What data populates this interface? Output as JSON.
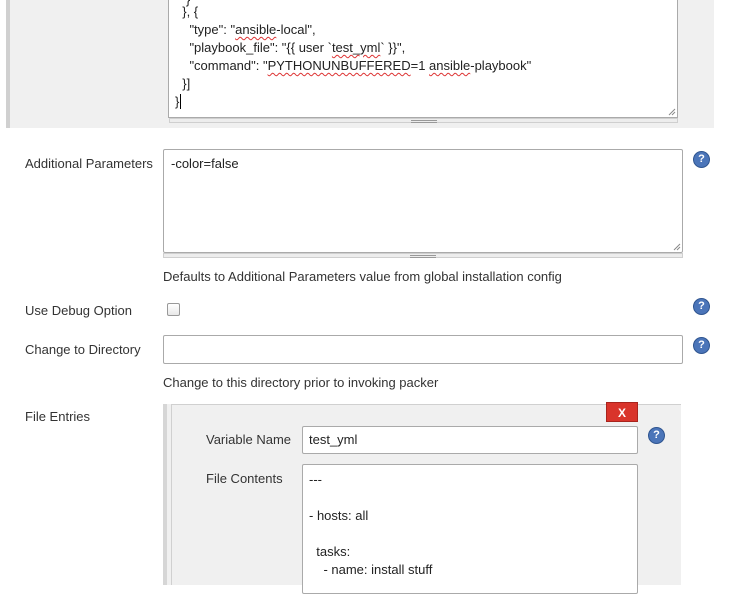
{
  "top_code": {
    "lines": [
      "  }, {",
      "    \"type\": \"",
      "ansible",
      "-local\",",
      "    \"playbook_file\": \"{{ user `",
      "test_yml",
      "` }}\",",
      "    \"command\": \"",
      "PYTHONUNBUFFERED",
      "=1 ",
      "ansible",
      "-playbook\"",
      "  }]",
      "}"
    ]
  },
  "additional_parameters": {
    "label": "Additional Parameters",
    "value": "-color=false",
    "description": "Defaults to Additional Parameters value from global installation config"
  },
  "debug_option": {
    "label": "Use Debug Option",
    "checked": false
  },
  "change_directory": {
    "label": "Change to Directory",
    "value": "",
    "description": "Change to this directory prior to invoking packer"
  },
  "file_entries": {
    "label": "File Entries",
    "delete_label": "X",
    "variable_name_label": "Variable Name",
    "variable_name_value": "test_yml",
    "file_contents_label": "File Contents",
    "file_contents_lines": [
      "---",
      "",
      "- hosts: all",
      "",
      "  tasks:",
      "    - name: install stuff"
    ]
  },
  "help_glyph": "?",
  "icons": {
    "help": "help-circle-icon",
    "resize": "resize-grip-icon"
  },
  "colors": {
    "help_blue": "#4b75b9",
    "delete_red": "#d9342b",
    "panel_gray": "#f0f0f0"
  }
}
